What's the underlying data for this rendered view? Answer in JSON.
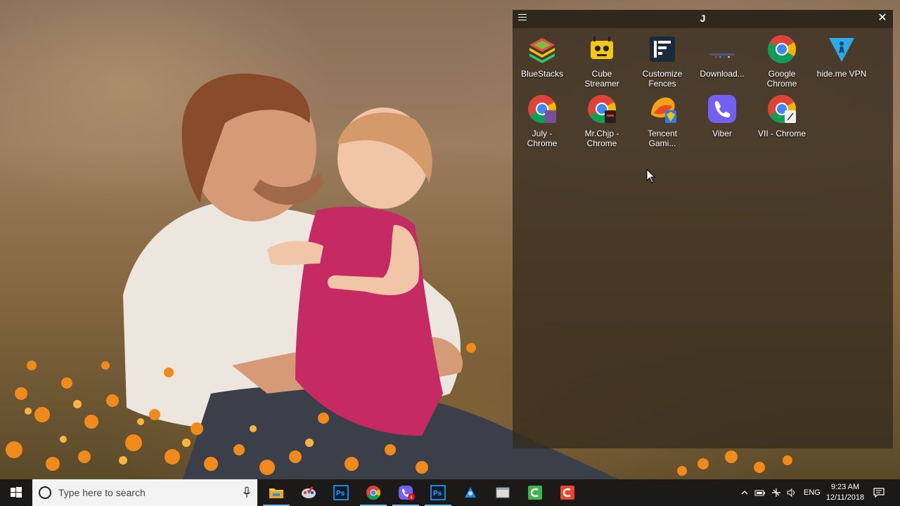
{
  "fence": {
    "title": "J",
    "menu_icon": "hamburger-icon",
    "close_label": "✕",
    "icons": [
      {
        "name": "bluestacks",
        "label": "BlueStacks",
        "icon": "bluestacks-icon"
      },
      {
        "name": "cube-streamer",
        "label": "Cube\nStreamer",
        "icon": "cube-streamer-icon"
      },
      {
        "name": "customize-fences",
        "label": "Customize\nFences",
        "icon": "fences-icon"
      },
      {
        "name": "download",
        "label": "Download...",
        "icon": "download-icon"
      },
      {
        "name": "google-chrome",
        "label": "Google\nChrome",
        "icon": "chrome-icon"
      },
      {
        "name": "hide-me-vpn",
        "label": "hide.me VPN",
        "icon": "hideme-vpn-icon"
      },
      {
        "name": "july-chrome",
        "label": "July -\nChrome",
        "icon": "chrome-profile-icon"
      },
      {
        "name": "mr-chjp-chrome",
        "label": "Mr.Chjp -\nChrome",
        "icon": "chrome-profile-icon"
      },
      {
        "name": "tencent-gaming",
        "label": "Tencent\nGami...",
        "icon": "tencent-icon"
      },
      {
        "name": "viber",
        "label": "Viber",
        "icon": "viber-icon"
      },
      {
        "name": "vii-chrome",
        "label": "VII - Chrome",
        "icon": "chrome-profile-icon"
      }
    ]
  },
  "taskbar": {
    "search_placeholder": "Type here to search",
    "apps": [
      {
        "name": "file-explorer",
        "icon": "folder-icon",
        "active": true
      },
      {
        "name": "paint-app",
        "icon": "paint-icon",
        "active": false
      },
      {
        "name": "photoshop-1",
        "icon": "photoshop-icon",
        "active": false
      },
      {
        "name": "chrome",
        "icon": "chrome-icon",
        "active": true
      },
      {
        "name": "viber",
        "icon": "viber-icon",
        "active": true,
        "badge": "4"
      },
      {
        "name": "photoshop-2",
        "icon": "photoshop-icon",
        "active": true
      },
      {
        "name": "app-blue",
        "icon": "blue-app-icon",
        "active": false
      },
      {
        "name": "app-window",
        "icon": "window-app-icon",
        "active": false
      },
      {
        "name": "camtasia-green",
        "icon": "camtasia-green-icon",
        "active": false
      },
      {
        "name": "camtasia-red",
        "icon": "camtasia-red-icon",
        "active": false
      }
    ],
    "tray": {
      "language": "ENG",
      "time": "9:23 AM",
      "date": "12/11/2018"
    }
  },
  "colors": {
    "taskbar_bg": "#1c1a19",
    "fence_bg": "#342a1e",
    "active_indicator": "#76b9ed"
  }
}
